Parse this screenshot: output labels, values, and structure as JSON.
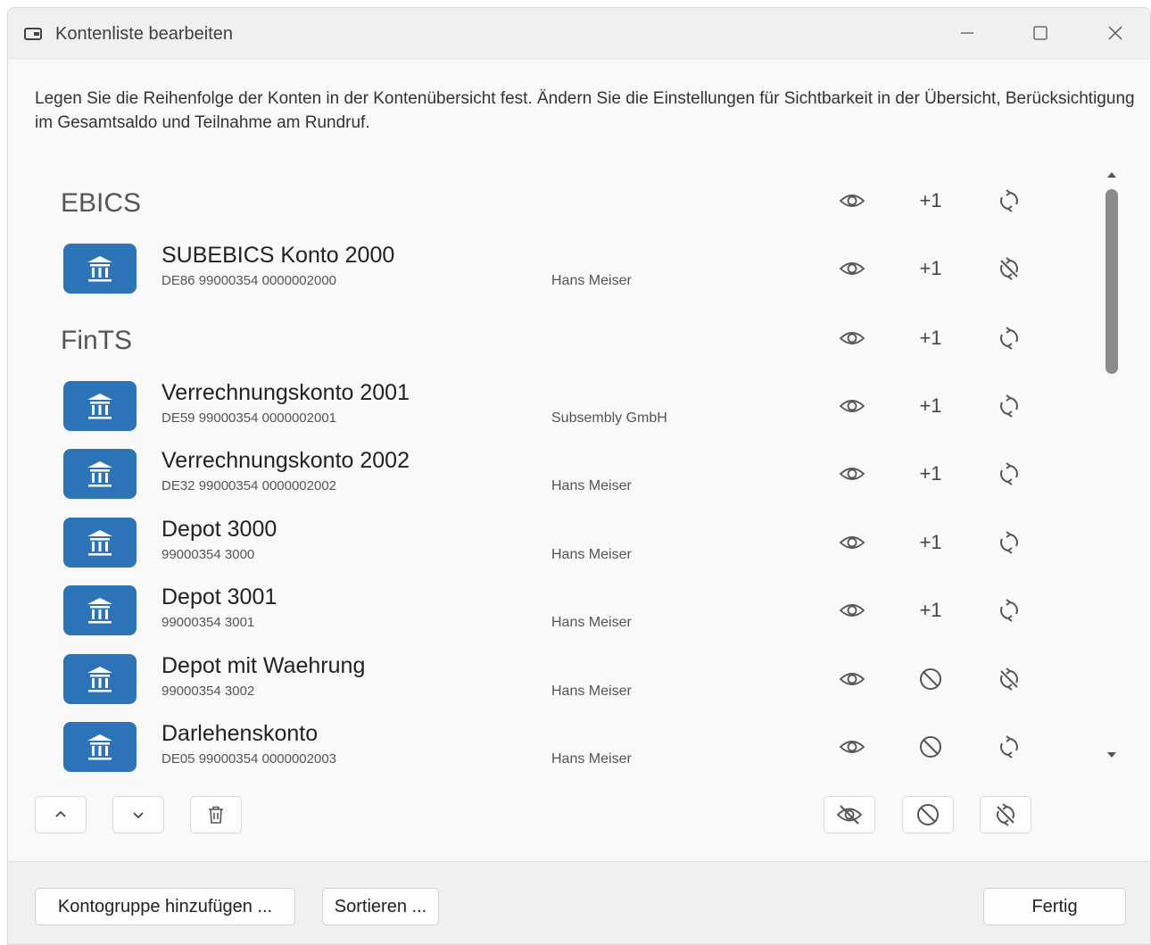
{
  "window": {
    "title": "Kontenliste bearbeiten",
    "icon": "wallet-icon",
    "controls": [
      "minimize-icon",
      "maximize-icon",
      "close-icon"
    ]
  },
  "description": "Legen Sie die Reihenfolge der Konten in der Kontenübersicht fest. Ändern Sie die Einstellungen für Sichtbarkeit in der Übersicht, Berücksichtigung im Gesamtsaldo und Teilnahme am Rundruf.",
  "columns": {
    "plus_label": "+1"
  },
  "groups": [
    {
      "name": "EBICS",
      "visible": true,
      "balance": "plus",
      "sync": "on"
    },
    {
      "name": "FinTS",
      "visible": true,
      "balance": "plus",
      "sync": "on"
    }
  ],
  "accounts": [
    {
      "name": "SUBEBICS Konto 2000",
      "iban": "DE86 99000354 0000002000",
      "owner": "Hans Meiser",
      "visible": true,
      "balance": "plus",
      "sync": "off"
    },
    {
      "name": "Verrechnungskonto 2001",
      "iban": "DE59 99000354 0000002001",
      "owner": "Subsembly GmbH",
      "visible": true,
      "balance": "plus",
      "sync": "on"
    },
    {
      "name": "Verrechnungskonto 2002",
      "iban": "DE32 99000354 0000002002",
      "owner": "Hans Meiser",
      "visible": true,
      "balance": "plus",
      "sync": "on"
    },
    {
      "name": "Depot 3000",
      "iban": "99000354 3000",
      "owner": "Hans Meiser",
      "visible": true,
      "balance": "plus",
      "sync": "on"
    },
    {
      "name": "Depot 3001",
      "iban": "99000354 3001",
      "owner": "Hans Meiser",
      "visible": true,
      "balance": "plus",
      "sync": "on"
    },
    {
      "name": "Depot mit Waehrung",
      "iban": "99000354 3002",
      "owner": "Hans Meiser",
      "visible": true,
      "balance": "excluded",
      "sync": "off"
    },
    {
      "name": "Darlehenskonto",
      "iban": "DE05 99000354 0000002003",
      "owner": "Hans Meiser",
      "visible": true,
      "balance": "excluded",
      "sync": "on"
    }
  ],
  "toolbar": {
    "left": [
      "chevron-up-icon",
      "chevron-down-icon",
      "trash-icon"
    ],
    "right": [
      "eye-off-icon",
      "block-icon",
      "sync-off-icon"
    ]
  },
  "footer": {
    "add_group_label": "Kontogruppe hinzufügen ...",
    "sort_label": "Sortieren ...",
    "done_label": "Fertig"
  },
  "colors": {
    "accent": "#2d73b8",
    "icon": "#555555"
  }
}
